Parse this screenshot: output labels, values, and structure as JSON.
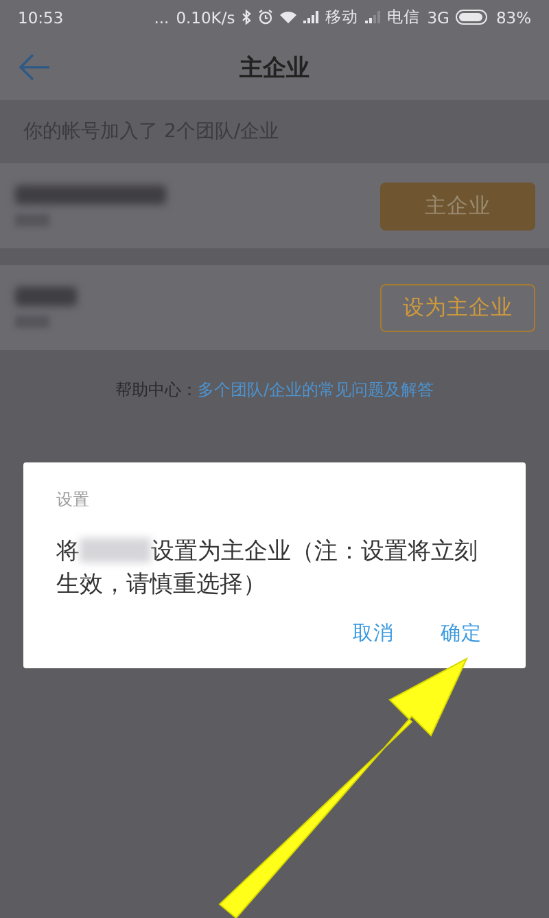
{
  "status_bar": {
    "time": "10:53",
    "dots": "...",
    "speed": "0.10K/s",
    "carrier_1": "移动",
    "carrier_2": "电信",
    "network": "3G",
    "battery": "83%"
  },
  "header": {
    "title": "主企业"
  },
  "section_label": "你的帐号加入了 2个团队/企业",
  "companies": [
    {
      "primary": true,
      "button": "主企业"
    },
    {
      "primary": false,
      "button": "设为主企业"
    }
  ],
  "help": {
    "label": "帮助中心：",
    "link": "多个团队/企业的常见问题及解答"
  },
  "dialog": {
    "title": "设置",
    "message_start": "将",
    "message_end": "设置为主企业（注：设置将立刻生效，请慎重选择）",
    "buttons": [
      {
        "label": "取消"
      },
      {
        "label": "确定"
      }
    ]
  }
}
